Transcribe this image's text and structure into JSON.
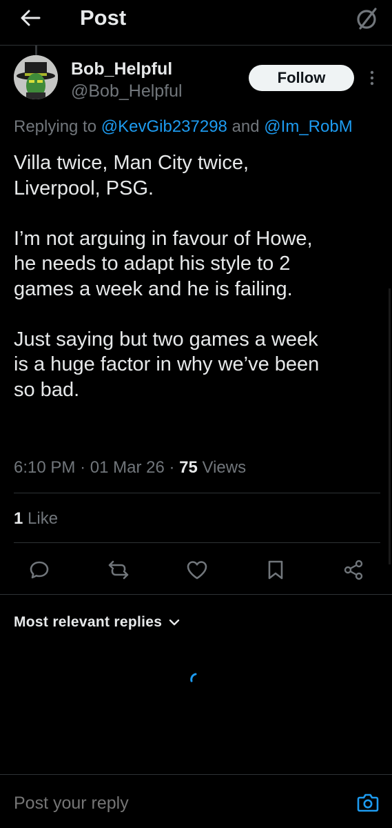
{
  "header": {
    "title": "Post",
    "back_icon": "arrow-left-icon",
    "right_icon": "grok-slash-icon"
  },
  "post": {
    "author": {
      "name": "Bob_Helpful",
      "handle": "@Bob_Helpful",
      "avatar": "avatar"
    },
    "follow_label": "Follow",
    "more_icon": "more-vertical-icon",
    "replying_prefix": "Replying to ",
    "replying_mentions": [
      "@KevGib237298",
      "@Im_RobM"
    ],
    "replying_joiner": " and ",
    "paragraphs": [
      "Villa twice, Man City twice,\nLiverpool, PSG.",
      "I’m not arguing in favour of Howe,\nhe needs to adapt his style to 2\ngames a week and he is failing.",
      "Just saying but two games a week\nis a huge factor in why we’ve been\nso bad."
    ],
    "time": "6:10 PM",
    "date": "01 Mar 26",
    "separator": "·",
    "views_count": "75",
    "views_label": "Views",
    "likes_count": "1",
    "likes_label": "Like"
  },
  "actions": [
    {
      "name": "reply-icon"
    },
    {
      "name": "repost-icon"
    },
    {
      "name": "like-icon"
    },
    {
      "name": "bookmark-icon"
    },
    {
      "name": "share-icon"
    }
  ],
  "replies": {
    "sort_label": "Most relevant replies",
    "sort_icon": "chevron-down-icon"
  },
  "composer": {
    "placeholder": "Post your reply",
    "camera_icon": "camera-icon"
  },
  "colors": {
    "background": "#000000",
    "text": "#e7e9ea",
    "secondary": "#71767b",
    "accent": "#1d9bf0",
    "divider": "#2f3336",
    "follow_bg": "#eff3f4"
  }
}
